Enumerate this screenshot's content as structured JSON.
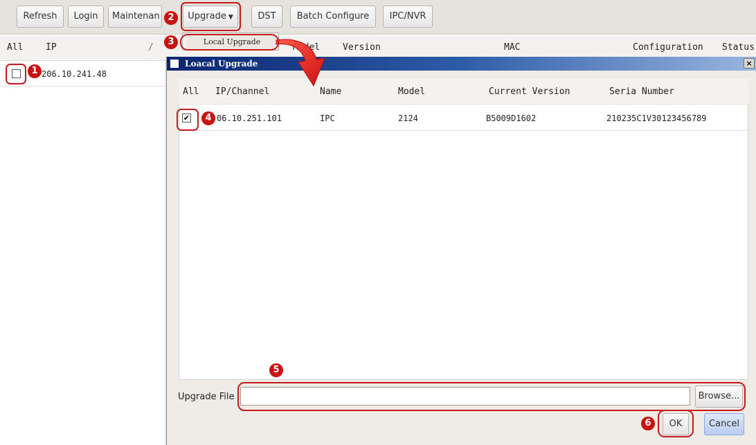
{
  "toolbar": {
    "refresh": "Refresh",
    "login": "Login",
    "maintenance": "Maintenan",
    "upgrade": "Upgrade",
    "dst": "DST",
    "batch_configure": "Batch Configure",
    "ipc_nvr": "IPC/NVR"
  },
  "device_list": {
    "headers": {
      "all": "All",
      "ip": "IP",
      "model": "Model",
      "version": "Version",
      "mac": "MAC",
      "configuration": "Configuration",
      "status": "Status"
    },
    "rows": [
      {
        "ip": "206.10.241.48",
        "checked": false
      }
    ]
  },
  "dropdown": {
    "items": [
      "Local Upgrade"
    ]
  },
  "dialog": {
    "title": "Loacal Upgrade",
    "close": "×",
    "headers": {
      "all": "All",
      "ip_channel": "IP/Channel",
      "name": "Name",
      "model": "Model",
      "current_version": "Current Version",
      "serial_number": "Seria Number"
    },
    "rows": [
      {
        "ip": "06.10.251.101",
        "name": "IPC",
        "model": "2124",
        "version": "B5009D1602",
        "serial": "210235C1V30123456789",
        "checked": true
      }
    ],
    "upgrade_file_label": "Upgrade File",
    "upgrade_file_value": "",
    "browse": "Browse...",
    "ok": "OK",
    "cancel": "Cancel"
  },
  "callouts": {
    "one": "1",
    "two": "2",
    "three": "3",
    "four": "4",
    "five": "5",
    "six": "6",
    "color": "#cc1111"
  },
  "colors": {
    "title_bar_start": "#0b2470",
    "title_bar_end": "#9ab5e0",
    "highlight": "#c41a1a"
  }
}
